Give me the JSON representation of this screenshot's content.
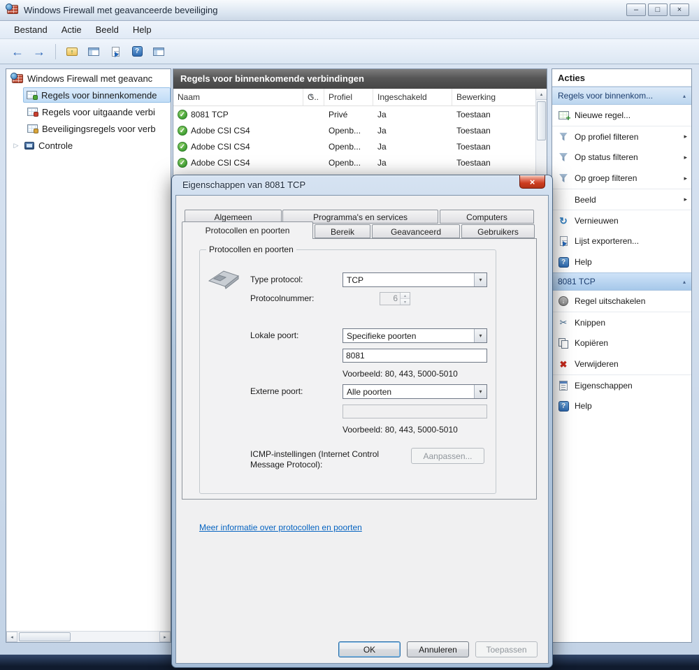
{
  "colors": {
    "selection_blue": "#c0dcf6",
    "list_header_dark": "#565656",
    "action_section_blue": "#bcd6ef",
    "check_green": "#3e9e32",
    "close_button_red": "#cc3c1f",
    "link_blue": "#0563c1",
    "frame_dark_navy": "#101b2e"
  },
  "icons": {
    "back_arrow": "←",
    "forward_arrow": "→",
    "up_arrow": "↑",
    "dropdown_arrow": "▾",
    "submenu_arrow": "▸",
    "collapse_arrow": "▴",
    "expand_arrow": "▷",
    "check": "✓",
    "cut": "✂",
    "delete": "✖",
    "refresh": "↻",
    "help": "?",
    "close": "×",
    "minimize": "–",
    "maximize": "□",
    "down_arrow": "↓",
    "spin_up": "▴",
    "spin_down": "▾",
    "sort": "▴",
    "scroll_left": "◂",
    "scroll_right": "▸",
    "scroll_up": "▴"
  },
  "window": {
    "title": "Windows Firewall met geavanceerde beveiliging",
    "menu": [
      "Bestand",
      "Actie",
      "Beeld",
      "Help"
    ]
  },
  "tree": {
    "root": "Windows Firewall met geavanc",
    "items": [
      "Regels voor binnenkomende",
      "Regels voor uitgaande verbi",
      "Beveiligingsregels voor verb",
      "Controle"
    ]
  },
  "list": {
    "title": "Regels voor binnenkomende verbindingen",
    "columns": [
      "Naam",
      "G..",
      "Profiel",
      "Ingeschakeld",
      "Bewerking"
    ],
    "rows": [
      {
        "naam": "8081 TCP",
        "profiel": "Privé",
        "ingeschakeld": "Ja",
        "bewerking": "Toestaan"
      },
      {
        "naam": "Adobe CSI CS4",
        "profiel": "Openb...",
        "ingeschakeld": "Ja",
        "bewerking": "Toestaan"
      },
      {
        "naam": "Adobe CSI CS4",
        "profiel": "Openb...",
        "ingeschakeld": "Ja",
        "bewerking": "Toestaan"
      },
      {
        "naam": "Adobe CSI CS4",
        "profiel": "Openb...",
        "ingeschakeld": "Ja",
        "bewerking": "Toestaan"
      }
    ]
  },
  "actions": {
    "title": "Acties",
    "section1": {
      "title": "Regels voor binnenkom...",
      "items": [
        "Nieuwe regel...",
        "Op profiel filteren",
        "Op status filteren",
        "Op groep filteren",
        "Beeld",
        "Vernieuwen",
        "Lijst exporteren...",
        "Help"
      ]
    },
    "section2": {
      "title": "8081 TCP",
      "items": [
        "Regel uitschakelen",
        "Knippen",
        "Kopiëren",
        "Verwijderen",
        "Eigenschappen",
        "Help"
      ]
    }
  },
  "dialog": {
    "title": "Eigenschappen van 8081 TCP",
    "tabs_back": [
      "Algemeen",
      "Programma's en services",
      "Computers"
    ],
    "tabs_front": [
      "Protocollen en poorten",
      "Bereik",
      "Geavanceerd",
      "Gebruikers"
    ],
    "group_title": "Protocollen en poorten",
    "type_protocol": {
      "label": "Type protocol:",
      "value": "TCP"
    },
    "protocol_number": {
      "label": "Protocolnummer:",
      "value": "6"
    },
    "local_port": {
      "label": "Lokale poort:",
      "value": "Specifieke poorten",
      "input": "8081",
      "example": "Voorbeeld: 80, 443, 5000-5010"
    },
    "remote_port": {
      "label": "Externe poort:",
      "value": "Alle poorten",
      "input": "",
      "example": "Voorbeeld: 80, 443, 5000-5010"
    },
    "icmp": {
      "label": "ICMP-instellingen (Internet Control Message Protocol):",
      "button": "Aanpassen..."
    },
    "link": "Meer informatie over protocollen en poorten",
    "buttons": {
      "ok": "OK",
      "cancel": "Annuleren",
      "apply": "Toepassen"
    }
  }
}
